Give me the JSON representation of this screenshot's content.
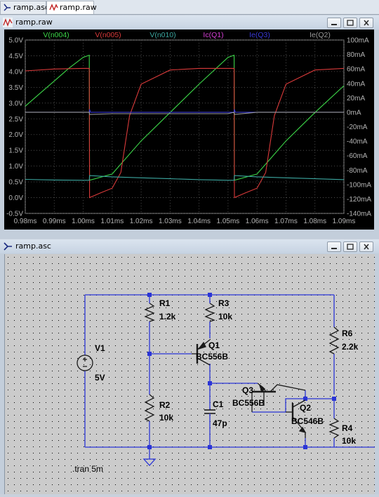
{
  "tabs": [
    {
      "label": "ramp.asc",
      "icon": "schematic-icon",
      "active": false
    },
    {
      "label": "ramp.raw",
      "icon": "waveform-icon",
      "active": true
    }
  ],
  "waveform_window": {
    "title": "ramp.raw",
    "traces": [
      {
        "label": "V(n004)",
        "color": "#3cd648"
      },
      {
        "label": "V(n005)",
        "color": "#d83a3a"
      },
      {
        "label": "V(n010)",
        "color": "#3ca7a0"
      },
      {
        "label": "Ic(Q1)",
        "color": "#d640d6"
      },
      {
        "label": "Ie(Q3)",
        "color": "#3a3ad8"
      },
      {
        "label": "Ie(Q2)",
        "color": "#9a9a9a"
      }
    ]
  },
  "chart_data": {
    "type": "line",
    "x_unit": "ms",
    "xlim": [
      0.98,
      1.09
    ],
    "x_ticks": [
      "0.98ms",
      "0.99ms",
      "1.00ms",
      "1.01ms",
      "1.02ms",
      "1.03ms",
      "1.04ms",
      "1.05ms",
      "1.06ms",
      "1.07ms",
      "1.08ms",
      "1.09ms"
    ],
    "ylim_left": [
      -0.5,
      5.0
    ],
    "y_ticks_left": [
      "5.0V",
      "4.5V",
      "4.0V",
      "3.5V",
      "3.0V",
      "2.5V",
      "2.0V",
      "1.5V",
      "1.0V",
      "0.5V",
      "0.0V",
      "-0.5V"
    ],
    "ylim_right": [
      -140,
      100
    ],
    "y_ticks_right": [
      "100mA",
      "80mA",
      "60mA",
      "40mA",
      "20mA",
      "0mA",
      "-20mA",
      "-40mA",
      "-60mA",
      "-80mA",
      "-100mA",
      "-120mA",
      "-140mA"
    ],
    "grid": true,
    "series": [
      {
        "name": "V(n004)",
        "axis": "left",
        "x": [
          0.98,
          0.985,
          0.99,
          0.995,
          1.0,
          1.0021,
          1.0022,
          1.01,
          1.02,
          1.03,
          1.04,
          1.05,
          1.0521,
          1.0522,
          1.06,
          1.07,
          1.08,
          1.09
        ],
        "y": [
          2.9,
          3.3,
          3.7,
          4.1,
          4.45,
          4.52,
          0.55,
          0.75,
          1.8,
          2.7,
          3.6,
          4.45,
          4.52,
          0.55,
          0.75,
          1.8,
          2.7,
          3.55
        ]
      },
      {
        "name": "V(n005)",
        "axis": "left",
        "x": [
          0.98,
          0.99,
          1.0,
          1.0021,
          1.0022,
          1.006,
          1.01,
          1.013,
          1.016,
          1.02,
          1.03,
          1.04,
          1.05,
          1.0521,
          1.0522,
          1.056,
          1.06,
          1.063,
          1.066,
          1.07,
          1.08,
          1.09
        ],
        "y": [
          4.02,
          4.08,
          4.1,
          4.1,
          0.0,
          0.15,
          0.3,
          0.8,
          2.6,
          3.6,
          4.05,
          4.1,
          4.1,
          4.1,
          0.0,
          0.15,
          0.3,
          0.8,
          2.6,
          3.6,
          4.05,
          4.1
        ]
      },
      {
        "name": "V(n010)",
        "axis": "left",
        "x": [
          0.98,
          0.99,
          1.0,
          1.0021,
          1.0022,
          1.01,
          1.02,
          1.03,
          1.04,
          1.05,
          1.0521,
          1.0522,
          1.06,
          1.07,
          1.08,
          1.09
        ],
        "y": [
          0.58,
          0.56,
          0.55,
          0.55,
          0.7,
          0.66,
          0.63,
          0.6,
          0.57,
          0.55,
          0.55,
          0.7,
          0.66,
          0.63,
          0.6,
          0.57
        ]
      },
      {
        "name": "Ie(Q3)",
        "axis": "right",
        "x": [
          0.98,
          1.0,
          1.0021,
          1.0022,
          1.0025,
          1.05,
          1.0521,
          1.0522,
          1.0525,
          1.09
        ],
        "y": [
          0,
          0,
          0,
          4,
          0,
          0,
          0,
          4,
          0,
          0
        ]
      },
      {
        "name": "Ie(Q2)",
        "axis": "right",
        "x": [
          0.98,
          1.0,
          1.0021,
          1.0022,
          1.01,
          1.05,
          1.0521,
          1.0522,
          1.06,
          1.09
        ],
        "y": [
          0,
          0,
          0,
          -3,
          -2,
          -2,
          0,
          -3,
          0,
          0
        ]
      }
    ]
  },
  "schematic_window": {
    "title": "ramp.asc",
    "components": [
      {
        "ref": "R1",
        "value": "1.2k"
      },
      {
        "ref": "R3",
        "value": "10k"
      },
      {
        "ref": "R6",
        "value": "2.2k"
      },
      {
        "ref": "V1",
        "value": "5V"
      },
      {
        "ref": "Q1",
        "value": "BC556B"
      },
      {
        "ref": "R2",
        "value": "10k"
      },
      {
        "ref": "C1",
        "value": "47p"
      },
      {
        "ref": "Q3",
        "value": "BC556B"
      },
      {
        "ref": "Q2",
        "value": "BC546B"
      },
      {
        "ref": "R4",
        "value": "10k"
      }
    ],
    "directive": ".tran 5m",
    "wire_color": "#2b35d6"
  }
}
